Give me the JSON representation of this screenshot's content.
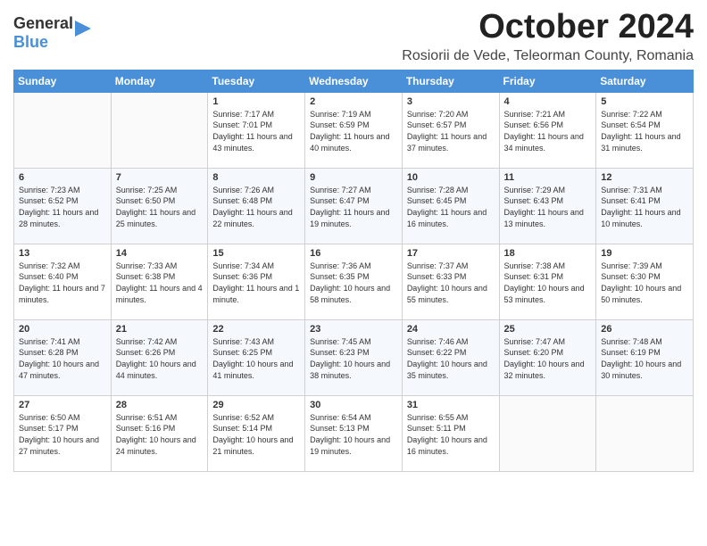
{
  "header": {
    "logo_general": "General",
    "logo_blue": "Blue",
    "month": "October 2024",
    "location": "Rosiorii de Vede, Teleorman County, Romania"
  },
  "weekdays": [
    "Sunday",
    "Monday",
    "Tuesday",
    "Wednesday",
    "Thursday",
    "Friday",
    "Saturday"
  ],
  "weeks": [
    [
      {
        "day": "",
        "content": ""
      },
      {
        "day": "",
        "content": ""
      },
      {
        "day": "1",
        "content": "Sunrise: 7:17 AM\nSunset: 7:01 PM\nDaylight: 11 hours and 43 minutes."
      },
      {
        "day": "2",
        "content": "Sunrise: 7:19 AM\nSunset: 6:59 PM\nDaylight: 11 hours and 40 minutes."
      },
      {
        "day": "3",
        "content": "Sunrise: 7:20 AM\nSunset: 6:57 PM\nDaylight: 11 hours and 37 minutes."
      },
      {
        "day": "4",
        "content": "Sunrise: 7:21 AM\nSunset: 6:56 PM\nDaylight: 11 hours and 34 minutes."
      },
      {
        "day": "5",
        "content": "Sunrise: 7:22 AM\nSunset: 6:54 PM\nDaylight: 11 hours and 31 minutes."
      }
    ],
    [
      {
        "day": "6",
        "content": "Sunrise: 7:23 AM\nSunset: 6:52 PM\nDaylight: 11 hours and 28 minutes."
      },
      {
        "day": "7",
        "content": "Sunrise: 7:25 AM\nSunset: 6:50 PM\nDaylight: 11 hours and 25 minutes."
      },
      {
        "day": "8",
        "content": "Sunrise: 7:26 AM\nSunset: 6:48 PM\nDaylight: 11 hours and 22 minutes."
      },
      {
        "day": "9",
        "content": "Sunrise: 7:27 AM\nSunset: 6:47 PM\nDaylight: 11 hours and 19 minutes."
      },
      {
        "day": "10",
        "content": "Sunrise: 7:28 AM\nSunset: 6:45 PM\nDaylight: 11 hours and 16 minutes."
      },
      {
        "day": "11",
        "content": "Sunrise: 7:29 AM\nSunset: 6:43 PM\nDaylight: 11 hours and 13 minutes."
      },
      {
        "day": "12",
        "content": "Sunrise: 7:31 AM\nSunset: 6:41 PM\nDaylight: 11 hours and 10 minutes."
      }
    ],
    [
      {
        "day": "13",
        "content": "Sunrise: 7:32 AM\nSunset: 6:40 PM\nDaylight: 11 hours and 7 minutes."
      },
      {
        "day": "14",
        "content": "Sunrise: 7:33 AM\nSunset: 6:38 PM\nDaylight: 11 hours and 4 minutes."
      },
      {
        "day": "15",
        "content": "Sunrise: 7:34 AM\nSunset: 6:36 PM\nDaylight: 11 hours and 1 minute."
      },
      {
        "day": "16",
        "content": "Sunrise: 7:36 AM\nSunset: 6:35 PM\nDaylight: 10 hours and 58 minutes."
      },
      {
        "day": "17",
        "content": "Sunrise: 7:37 AM\nSunset: 6:33 PM\nDaylight: 10 hours and 55 minutes."
      },
      {
        "day": "18",
        "content": "Sunrise: 7:38 AM\nSunset: 6:31 PM\nDaylight: 10 hours and 53 minutes."
      },
      {
        "day": "19",
        "content": "Sunrise: 7:39 AM\nSunset: 6:30 PM\nDaylight: 10 hours and 50 minutes."
      }
    ],
    [
      {
        "day": "20",
        "content": "Sunrise: 7:41 AM\nSunset: 6:28 PM\nDaylight: 10 hours and 47 minutes."
      },
      {
        "day": "21",
        "content": "Sunrise: 7:42 AM\nSunset: 6:26 PM\nDaylight: 10 hours and 44 minutes."
      },
      {
        "day": "22",
        "content": "Sunrise: 7:43 AM\nSunset: 6:25 PM\nDaylight: 10 hours and 41 minutes."
      },
      {
        "day": "23",
        "content": "Sunrise: 7:45 AM\nSunset: 6:23 PM\nDaylight: 10 hours and 38 minutes."
      },
      {
        "day": "24",
        "content": "Sunrise: 7:46 AM\nSunset: 6:22 PM\nDaylight: 10 hours and 35 minutes."
      },
      {
        "day": "25",
        "content": "Sunrise: 7:47 AM\nSunset: 6:20 PM\nDaylight: 10 hours and 32 minutes."
      },
      {
        "day": "26",
        "content": "Sunrise: 7:48 AM\nSunset: 6:19 PM\nDaylight: 10 hours and 30 minutes."
      }
    ],
    [
      {
        "day": "27",
        "content": "Sunrise: 6:50 AM\nSunset: 5:17 PM\nDaylight: 10 hours and 27 minutes."
      },
      {
        "day": "28",
        "content": "Sunrise: 6:51 AM\nSunset: 5:16 PM\nDaylight: 10 hours and 24 minutes."
      },
      {
        "day": "29",
        "content": "Sunrise: 6:52 AM\nSunset: 5:14 PM\nDaylight: 10 hours and 21 minutes."
      },
      {
        "day": "30",
        "content": "Sunrise: 6:54 AM\nSunset: 5:13 PM\nDaylight: 10 hours and 19 minutes."
      },
      {
        "day": "31",
        "content": "Sunrise: 6:55 AM\nSunset: 5:11 PM\nDaylight: 10 hours and 16 minutes."
      },
      {
        "day": "",
        "content": ""
      },
      {
        "day": "",
        "content": ""
      }
    ]
  ]
}
